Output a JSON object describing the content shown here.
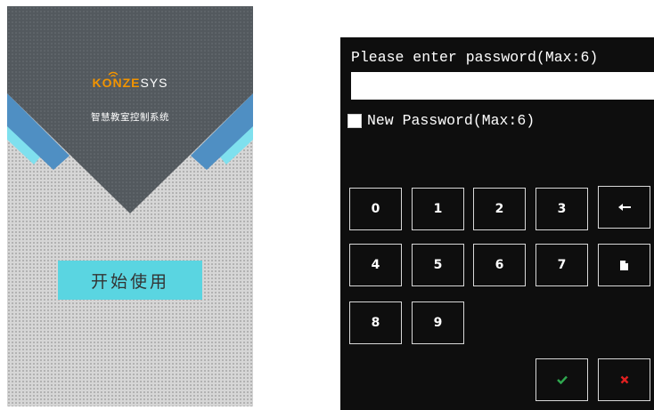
{
  "splash": {
    "brand_part1": "KONZE",
    "brand_part2": "SYS",
    "subtitle": "智慧教室控制系统",
    "start_label": "开始使用",
    "colors": {
      "background": "#d6d6d6",
      "dark": "#53595e",
      "blue_band": "#4f8fc3",
      "cyan_band": "#7fe0ee",
      "button": "#5ad5e1",
      "brand_orange": "#f29400"
    }
  },
  "password": {
    "prompt": "Please enter password(Max:6)",
    "value": "",
    "new_password_label": "New Password(Max:6)",
    "new_password_checked": false,
    "keys": {
      "k0": "0",
      "k1": "1",
      "k2": "2",
      "k3": "3",
      "k4": "4",
      "k5": "5",
      "k6": "6",
      "k7": "7",
      "k8": "8",
      "k9": "9"
    },
    "icons": {
      "backspace": "left-arrow-icon",
      "clear": "document-icon",
      "confirm": "check-icon",
      "cancel": "x-icon"
    },
    "colors": {
      "background": "#0e0e0e",
      "confirm": "#2fa84f",
      "cancel": "#e02020"
    }
  }
}
